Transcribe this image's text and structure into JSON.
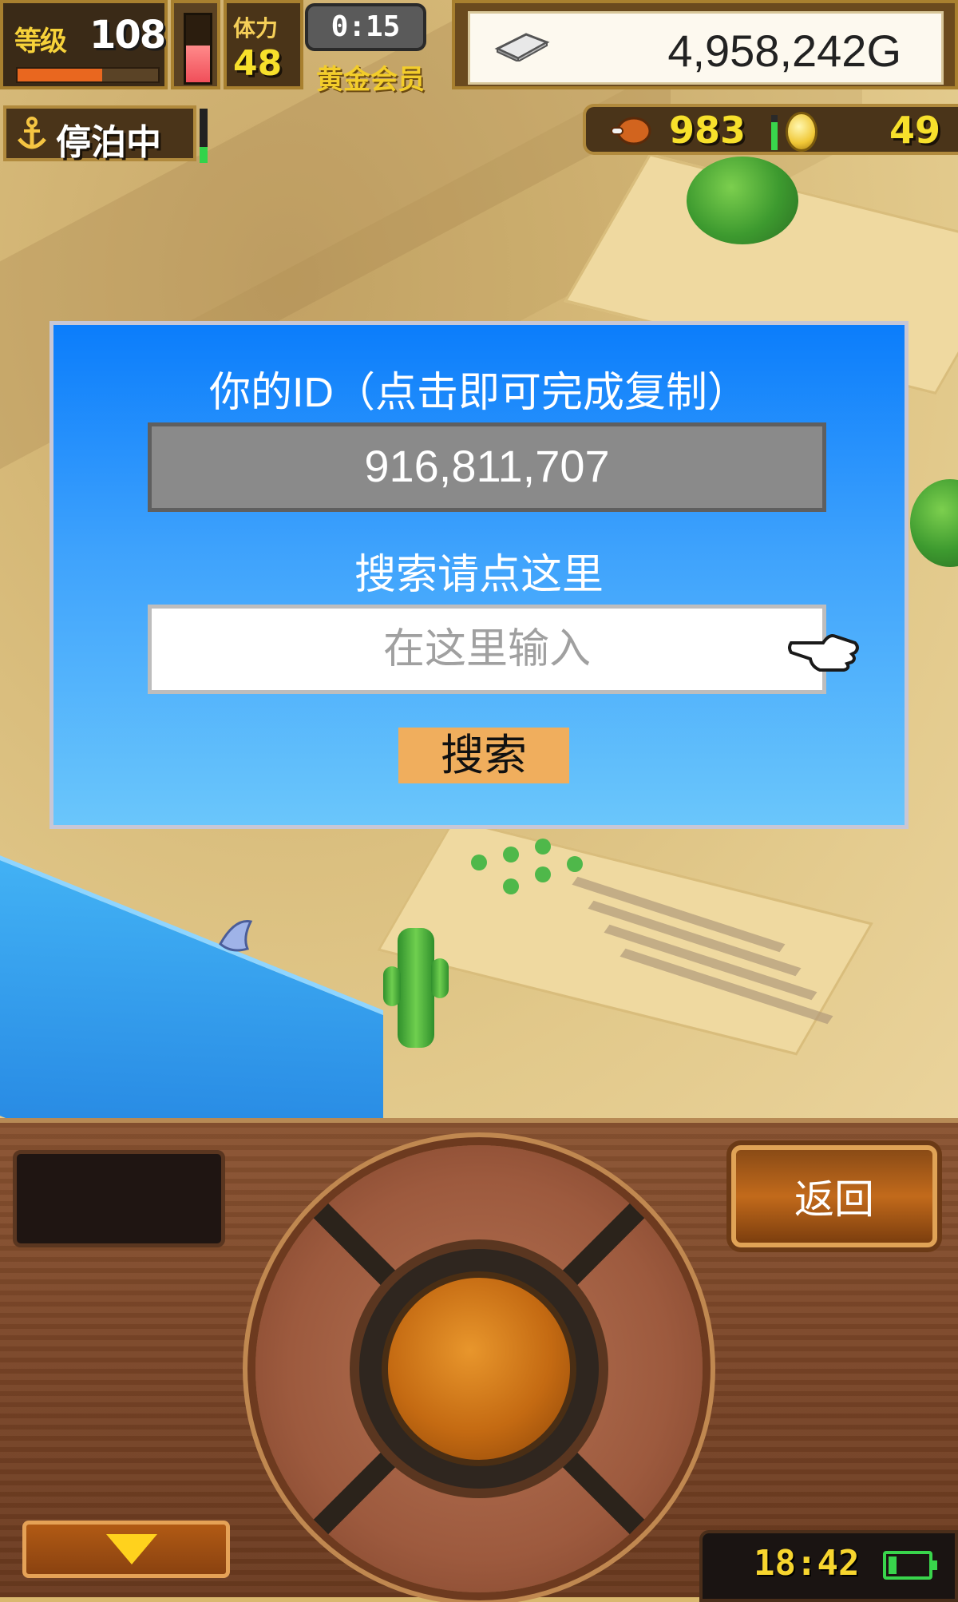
{
  "hud": {
    "level_label": "等级",
    "level_value": "108",
    "xp_progress": 0.6,
    "stamina_level": 0.55,
    "hp_label": "体力",
    "hp_value": "48",
    "timer": "0:15",
    "membership": "黄金会员",
    "money": "4,958,242G",
    "anchor_status": "停泊中",
    "meat_count": "983",
    "coin_count": "49"
  },
  "dialog": {
    "id_title": "你的ID（点击即可完成复制）",
    "player_id": "916,811,707",
    "search_title": "搜索请点这里",
    "search_placeholder": "在这里输入",
    "search_button": "搜索"
  },
  "controls": {
    "back_button": "返回",
    "clock": "18:42",
    "battery_level": 0.3
  },
  "colors": {
    "dialog_top": "#0b7dfb",
    "dialog_bottom": "#6ac6fb",
    "search_button": "#f0ae5d",
    "gold_text": "#f7e02b",
    "wood": "#7a4527"
  },
  "icons": [
    "silver-bar-icon",
    "anchor-icon",
    "meat-icon",
    "coin-icon",
    "pointing-hand-icon",
    "down-arrow-icon",
    "battery-icon"
  ]
}
